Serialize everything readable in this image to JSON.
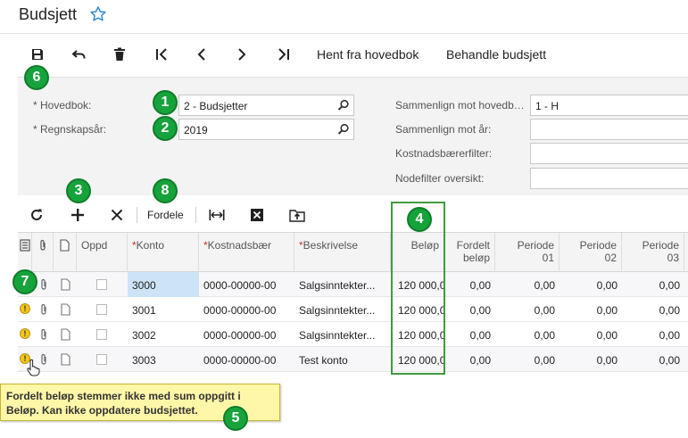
{
  "page": {
    "title": "Budsjett"
  },
  "toolbar": {
    "fetch_label": "Hent fra hovedbok",
    "process_label": "Behandle budsjett"
  },
  "form": {
    "ledger": {
      "label": "Hovedbok:",
      "value": "2 - Budsjetter"
    },
    "fiscal_year": {
      "label": "Regnskapsår:",
      "value": "2019"
    },
    "compare_ledger": {
      "label": "Sammenlign mot hovedb…",
      "value": "1 - H"
    },
    "compare_year": {
      "label": "Sammenlign mot år:",
      "value": ""
    },
    "cost_filter": {
      "label": "Kostnadsbærerfilter:",
      "value": ""
    },
    "node_filter": {
      "label": "Nodefilter oversikt:",
      "value": ""
    }
  },
  "grid_toolbar": {
    "distribute_label": "Fordele"
  },
  "grid": {
    "headers": {
      "update": "Oppd",
      "account": "Konto",
      "cost_carrier": "Kostnadsbær",
      "description": "Beskrivelse",
      "amount": "Beløp",
      "distributed_1": "Fordelt",
      "distributed_2": "beløp",
      "period1_a": "Periode",
      "period1_b": "01",
      "period2_a": "Periode",
      "period2_b": "02",
      "period3_a": "Periode",
      "period3_b": "03"
    },
    "rows": [
      {
        "account": "3000",
        "cost_carrier": "0000-00000-00",
        "description": "Salgsinntekter...",
        "amount": "120 000,0",
        "distributed": "0,00",
        "p1": "0,00",
        "p2": "0,00",
        "p3": "0,00"
      },
      {
        "account": "3001",
        "cost_carrier": "0000-00000-00",
        "description": "Salgsinntekter...",
        "amount": "120 000,0",
        "distributed": "0,00",
        "p1": "0,00",
        "p2": "0,00",
        "p3": "0,00"
      },
      {
        "account": "3002",
        "cost_carrier": "0000-00000-00",
        "description": "Salgsinntekter...",
        "amount": "120 000,0",
        "distributed": "0,00",
        "p1": "0,00",
        "p2": "0,00",
        "p3": "0,00"
      },
      {
        "account": "3003",
        "cost_carrier": "0000-00000-00",
        "description": "Test konto",
        "amount": "120 000,0",
        "distributed": "0,00",
        "p1": "0,00",
        "p2": "0,00",
        "p3": "0,00"
      }
    ]
  },
  "tooltip": {
    "line1": "Fordelt beløp stemmer ikke med sum oppgitt i",
    "line2": "Beløp. Kan ikke oppdatere budsjettet."
  },
  "callouts": [
    "1",
    "2",
    "3",
    "4",
    "5",
    "6",
    "7",
    "8"
  ],
  "colors": {
    "callout_green": "#17a33b",
    "active_cell": "#cde4f7",
    "tooltip_bg": "#fff7a8",
    "star_blue": "#2a8ad4"
  }
}
